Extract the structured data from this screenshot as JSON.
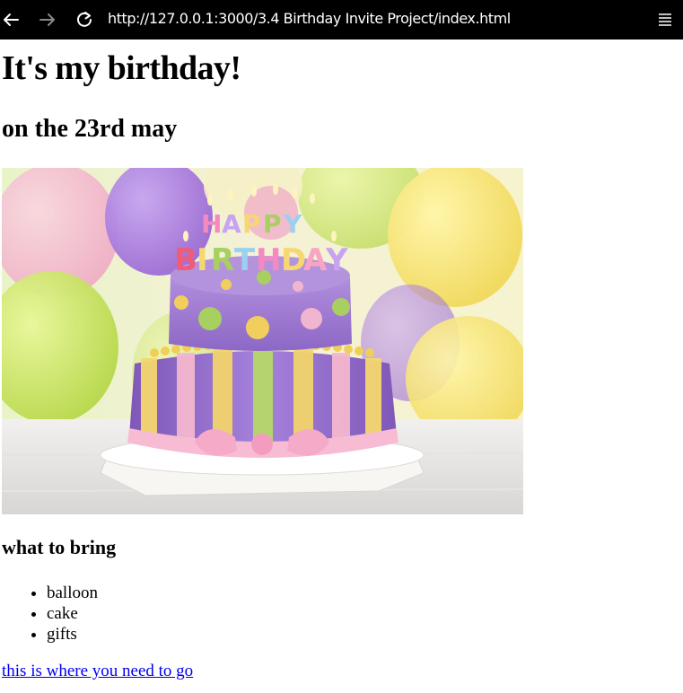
{
  "browser": {
    "url": "http://127.0.0.1:3000/3.4 Birthday Invite Project/index.html",
    "icons": {
      "back": "arrow-left-icon",
      "forward": "arrow-right-icon",
      "reload": "reload-icon",
      "menu": "hamburger-menu-icon"
    },
    "toolbar_color": "#000000"
  },
  "page": {
    "heading": "It's my birthday!",
    "subheading": "on the 23rd may",
    "image_alt": "birthday cake",
    "bring_heading": "what to bring",
    "items": [
      "balloon",
      "cake",
      "gifts"
    ],
    "link_text": "this is where you need to go",
    "link_color": "#0000ee"
  }
}
